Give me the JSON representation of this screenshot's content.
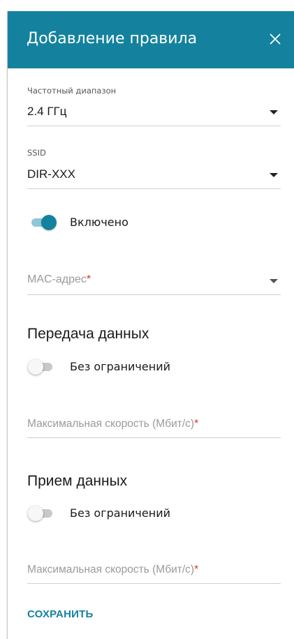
{
  "dialog": {
    "title": "Добавление правила",
    "close_label": "×"
  },
  "frequency": {
    "label": "Частотный диапазон",
    "value": "2.4 ГГц"
  },
  "ssid": {
    "label": "SSID",
    "value": "DIR-XXX"
  },
  "enabled": {
    "label": "Включено",
    "state": true
  },
  "mac": {
    "placeholder": "MAC-адрес",
    "required_mark": "*"
  },
  "transmit": {
    "title": "Передача данных",
    "unlimited_label": "Без ограничений",
    "unlimited_state": false,
    "max_speed_placeholder": "Максимальная скорость (Мбит/с)",
    "required_mark": "*"
  },
  "receive": {
    "title": "Прием данных",
    "unlimited_label": "Без ограничений",
    "unlimited_state": false,
    "max_speed_placeholder": "Максимальная скорость (Мбит/с)",
    "required_mark": "*"
  },
  "actions": {
    "save_label": "СОХРАНИТЬ"
  },
  "colors": {
    "accent": "#14829f",
    "required": "#d9332b"
  },
  "icons": {
    "close": "close-icon",
    "dropdown": "chevron-down-icon"
  }
}
